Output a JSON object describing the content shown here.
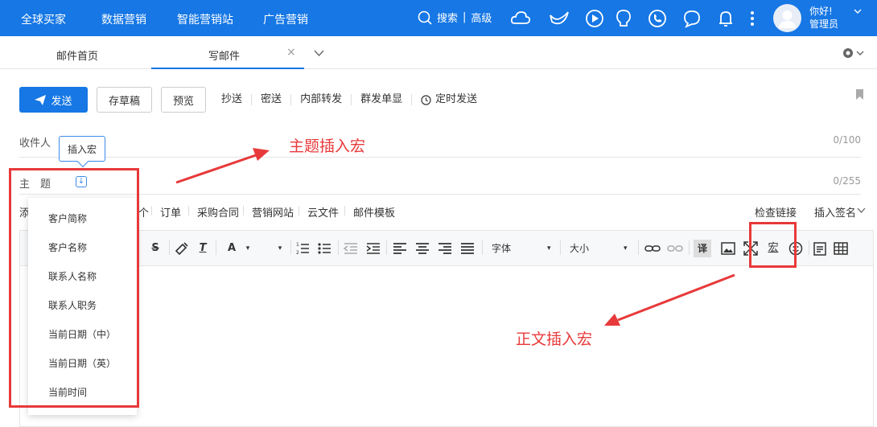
{
  "topnav": {
    "items": [
      "全球买家",
      "数据营销",
      "智能营销站",
      "广告营销"
    ],
    "search_label": "搜索",
    "search_divider": "|",
    "advanced_label": "高级",
    "icons": [
      "cloud-icon",
      "bird-icon",
      "play-icon",
      "bulb-icon",
      "phone-icon",
      "chat-icon",
      "bell-icon",
      "more-icon"
    ],
    "greeting": "你好!",
    "user_role": "管理员"
  },
  "tabs": {
    "home": "邮件首页",
    "compose": "写邮件",
    "close": "×"
  },
  "toolbar": {
    "send": "发送",
    "save_draft": "存草稿",
    "preview": "预览",
    "links": [
      "抄送",
      "密送",
      "内部转发",
      "群发单显"
    ],
    "schedule": "定时发送"
  },
  "fields": {
    "recipient_label": "收件人",
    "recipient_counter": "0/100",
    "subject_label": "主　题",
    "subject_counter": "0/255"
  },
  "tooltip": "插入宏",
  "attach_row": {
    "first": "添",
    "partial": "个",
    "items": [
      "订单",
      "采购合同",
      "营销网站",
      "云文件",
      "邮件模板"
    ],
    "check_links": "检查链接",
    "insert_signature": "插入签名"
  },
  "editor_toolbar": {
    "font": "字体",
    "size": "大小",
    "macro": "宏",
    "translate": "译"
  },
  "macro_dropdown": [
    "客户简称",
    "客户名称",
    "联系人名称",
    "联系人职务",
    "当前日期（中）",
    "当前日期（英）",
    "当前时间"
  ],
  "annotations": {
    "subject_macro": "主题插入宏",
    "body_macro": "正文插入宏"
  },
  "colors": {
    "primary": "#1677e5",
    "annotation": "#e8393a"
  }
}
